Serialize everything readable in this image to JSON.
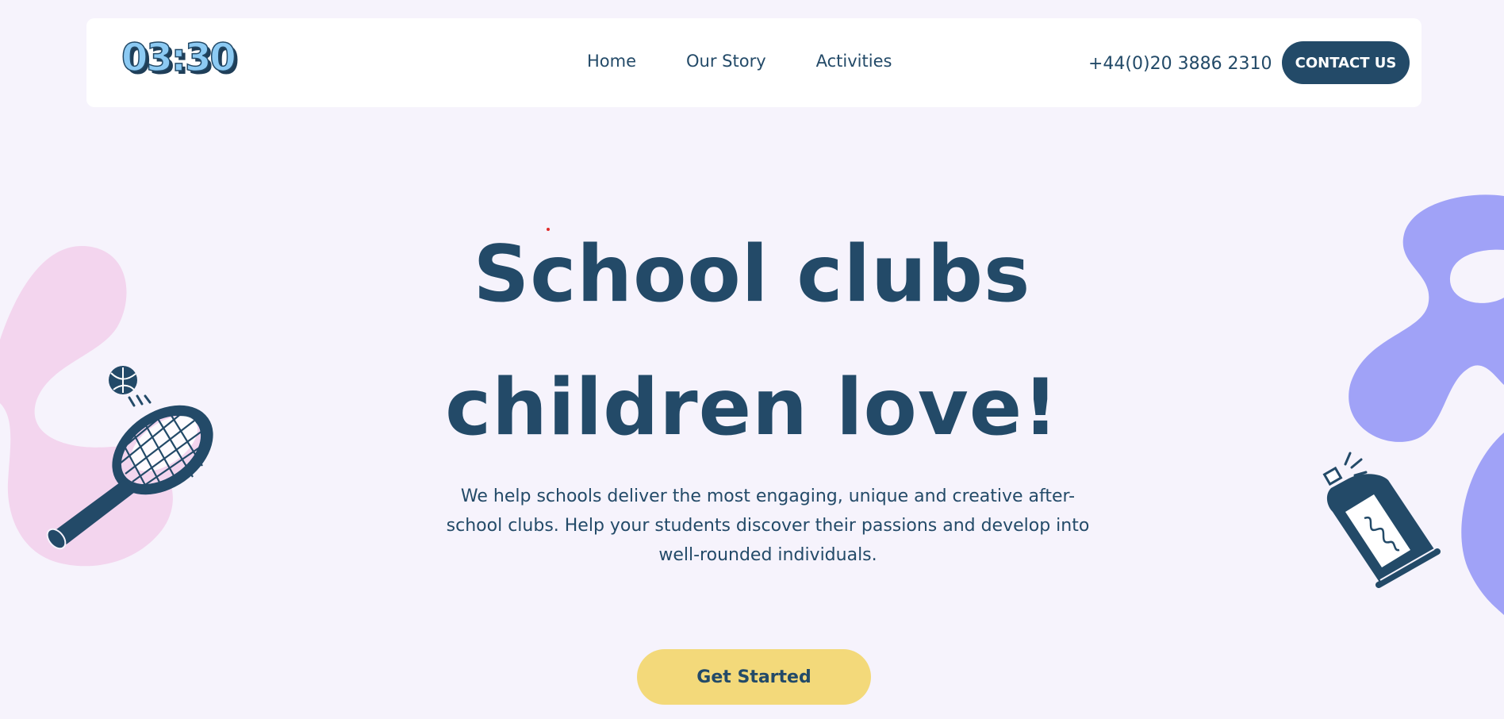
{
  "header": {
    "logo_text": "03:30",
    "nav": [
      {
        "label": "Home"
      },
      {
        "label": "Our Story"
      },
      {
        "label": "Activities"
      }
    ],
    "phone": "+44(0)20 3886 2310",
    "contact_label": "CONTACT US"
  },
  "hero": {
    "title_line1": "School clubs",
    "title_line2": "children love!",
    "subtitle": "We help schools deliver the most engaging, unique and creative after-school clubs. Help your students discover their passions and develop into well-rounded individuals.",
    "cta_label": "Get Started"
  },
  "colors": {
    "background": "#f6f3fc",
    "primary": "#234a68",
    "cta": "#f3d97a",
    "pink_blob": "#f3d5ee",
    "purple_blob": "#a0a2f7",
    "logo_fill": "#8ccaf3"
  },
  "icons": {
    "logo": "logo-0330",
    "left_decoration": "tennis-racket-icon",
    "right_decoration": "spray-can-icon"
  }
}
